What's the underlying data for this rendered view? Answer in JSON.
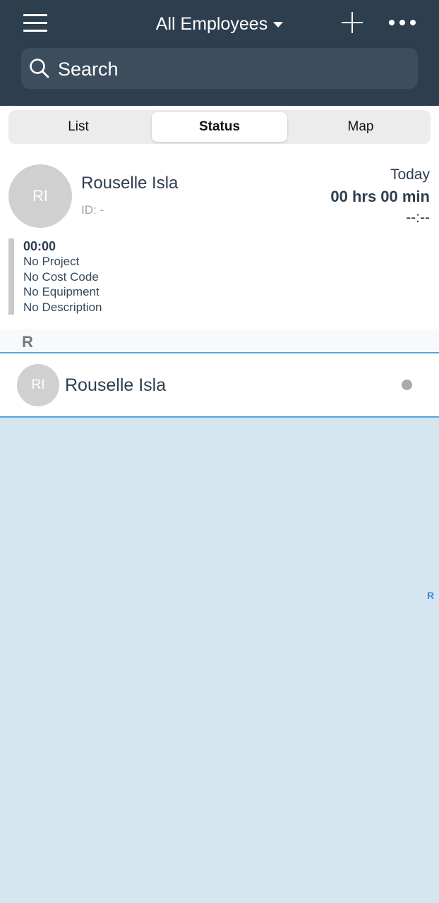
{
  "header": {
    "title": "All Employees",
    "search_placeholder": "Search",
    "icons": {
      "menu": "hamburger-menu-icon",
      "add": "plus-icon",
      "more": "more-dots-icon",
      "search": "search-icon"
    }
  },
  "tabs": [
    {
      "label": "List",
      "active": false
    },
    {
      "label": "Status",
      "active": true
    },
    {
      "label": "Map",
      "active": false
    }
  ],
  "status_card": {
    "initials": "RI",
    "name": "Rouselle Isla",
    "id_label": "ID:  -",
    "day": "Today",
    "hours": "00 hrs 00 min",
    "clock": "--:--",
    "entry": {
      "time": "00:00",
      "project": "No Project",
      "cost_code": "No Cost Code",
      "equipment": "No Equipment",
      "description": "No Description"
    }
  },
  "list": {
    "section_letter": "R",
    "rows": [
      {
        "initials": "RI",
        "name": "Rouselle Isla",
        "status_color": "#aaaaaa"
      }
    ]
  },
  "index": [
    "R"
  ],
  "colors": {
    "header_bg": "#2d3e4f",
    "accent": "#5ba4d8",
    "index_blue": "#3b8ed0",
    "list_bg": "#d6e6f0"
  }
}
